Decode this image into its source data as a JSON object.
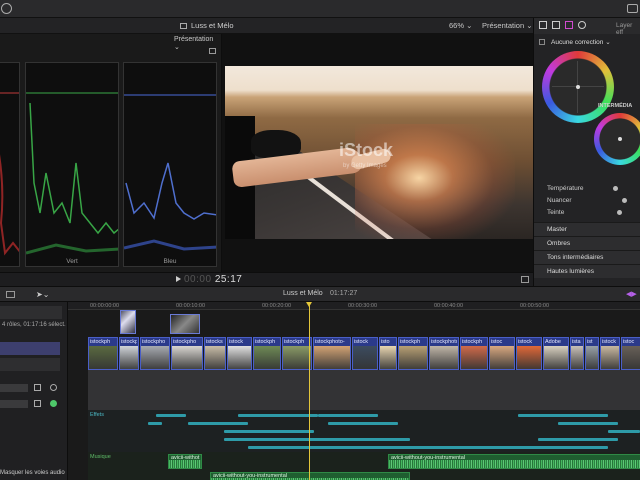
{
  "viewer": {
    "title": "Luss et Mélo",
    "zoom": "66%",
    "presentation": "Présentation",
    "timecode_dim": "00:00",
    "timecode": "25:17",
    "watermark": "iStock",
    "watermark_sub": "by Getty Images"
  },
  "scopes": {
    "presentation": "Présentation",
    "channels": [
      {
        "label": "",
        "color": "#e04848"
      },
      {
        "label": "Vert",
        "color": "#4cd25a"
      },
      {
        "label": "Bleu",
        "color": "#5a7ce8"
      }
    ]
  },
  "inspector": {
    "layer_label": "Layer eff",
    "correction": "Aucune correction",
    "intermediates_label": "INTERMÉDIA",
    "sliders": [
      {
        "label": "Température",
        "value": 0.75
      },
      {
        "label": "Nuancer",
        "value": 0.85
      },
      {
        "label": "Teinte",
        "value": 0.8
      }
    ],
    "sections": [
      "Master",
      "Ombres",
      "Tons intermédiaires",
      "Hautes lumières"
    ]
  },
  "timeline": {
    "title": "Luss et Mélo",
    "duration": "01:17:27",
    "selection": "4 rôles, 01:17:16 sélect.",
    "hide_roles": "Masquer les voies audio",
    "ruler": [
      "00:00:00:00",
      "00:00:10:00",
      "00:00:20:00",
      "00:00:30:00",
      "00:00:40:00",
      "00:00:50:00"
    ],
    "effects_lane": "Effets",
    "music_lane": "Musique",
    "clips": [
      {
        "name": "istockph",
        "color": "#5a6a40"
      },
      {
        "name": "istockph",
        "color": "#cfd3d8"
      },
      {
        "name": "istockpho",
        "color": "#a7aab0"
      },
      {
        "name": "istockpho",
        "color": "#d8d5d0"
      },
      {
        "name": "istocks",
        "color": "#c9bda8"
      },
      {
        "name": "istock",
        "color": "#e0e0e0"
      },
      {
        "name": "istockph",
        "color": "#6e8a55"
      },
      {
        "name": "istockph",
        "color": "#8a9a66"
      },
      {
        "name": "istockphoto-",
        "color": "#d2a374"
      },
      {
        "name": "istock",
        "color": "#3c4c60"
      },
      {
        "name": "isto",
        "color": "#e8d5b0"
      },
      {
        "name": "istockph",
        "color": "#b8a074"
      },
      {
        "name": "istockphoto",
        "color": "#c0b6a8"
      },
      {
        "name": "istockph",
        "color": "#d06a4a"
      },
      {
        "name": "istoc",
        "color": "#d8a880"
      },
      {
        "name": "istock",
        "color": "#e06838"
      },
      {
        "name": "Adobe",
        "color": "#d8d0c0"
      },
      {
        "name": "ista",
        "color": "#c8c0b8"
      },
      {
        "name": "ist",
        "color": "#98a0a8"
      },
      {
        "name": "istock",
        "color": "#c8b8a0"
      },
      {
        "name": "istoc",
        "color": "#686058"
      }
    ],
    "audio": [
      {
        "name": "avicii-withot"
      },
      {
        "name": "avicii-without-you-instrumental"
      },
      {
        "name": "avicii-without-you-instrumental"
      }
    ]
  }
}
